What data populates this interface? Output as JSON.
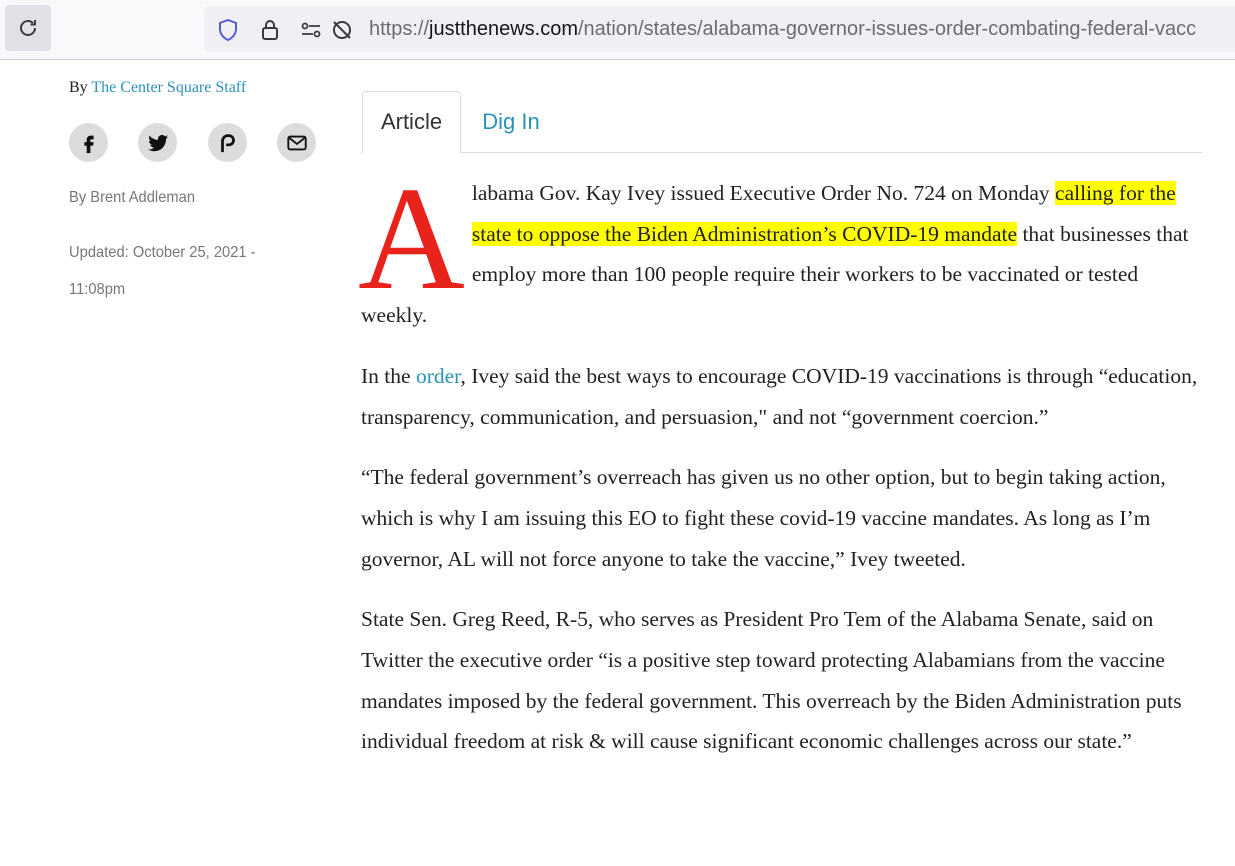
{
  "browser": {
    "url_prefix": "https://",
    "url_domain": "justthenews.com",
    "url_path": "/nation/states/alabama-governor-issues-order-combating-federal-vacc"
  },
  "sidebar": {
    "by_label": "By",
    "source": "The Center Square Staff",
    "author": "By Brent Addleman",
    "updated_line1": "Updated: October 25, 2021 -",
    "updated_line2": "11:08pm",
    "share_icons": [
      "facebook-icon",
      "twitter-icon",
      "parler-icon",
      "email-icon"
    ]
  },
  "tabs": {
    "article": "Article",
    "dig_in": "Dig In"
  },
  "article": {
    "dropcap": "A",
    "p1_start": "labama Gov. Kay Ivey issued Executive Order No. 724 on Monday ",
    "p1_highlight": "calling for the state to oppose the Biden Administration’s COVID-19 mandate",
    "p1_end": " that businesses that employ more than 100 people require their workers to be vaccinated or tested weekly.",
    "p2_start": "In the ",
    "p2_link": "order",
    "p2_end": ", Ivey said the best ways to encourage COVID-19 vaccinations is through “education, transparency, communication, and persuasion,\" and not “government coercion.”",
    "p3": "“The federal government’s overreach has given us no other option, but to begin taking action, which is why I am issuing this EO to fight these covid-19 vaccine mandates. As long as I’m governor, AL will not force anyone to take the vaccine,” Ivey tweeted.",
    "p4": "State Sen. Greg Reed, R-5, who serves as President Pro Tem of the Alabama Senate, said on Twitter the executive order “is a positive step toward protecting Alabamians from the vaccine mandates imposed by the federal government. This overreach by the Biden Administration puts individual freedom at risk & will cause significant economic challenges across our state.”"
  },
  "colors": {
    "link": "#2a93b8",
    "dropcap": "#e8231b",
    "highlight": "#ffff00"
  }
}
